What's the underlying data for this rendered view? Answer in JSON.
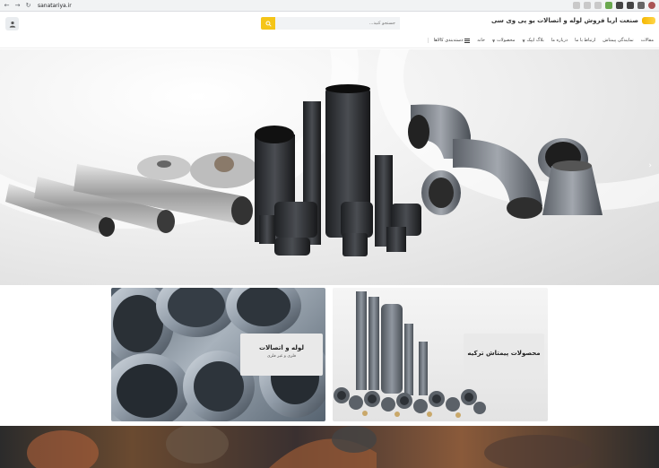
{
  "browser": {
    "url": "sanatariya.ir",
    "back_icon": "arrow-left-icon",
    "forward_icon": "arrow-right-icon",
    "reload_icon": "reload-icon"
  },
  "header": {
    "brand_title": "صنعت اریا فروش لوله و اتصالات یو پی وی سی",
    "search_placeholder": "جستجو کنید...",
    "search_icon": "search-icon",
    "user_icon": "user-icon",
    "accent_color": "#f5c518"
  },
  "nav": {
    "categories_label": "دسته‌بندی کالاها",
    "items": [
      "خانه",
      "محصولات",
      "بلاگ ایپک",
      "درباره ما",
      "ارتباط با ما",
      "نمایندگی پیمتاش",
      "مقالات"
    ]
  },
  "cards": {
    "pipes": {
      "title": "لوله و اتصالات",
      "subtitle": "فلزی و غیر فلزی"
    },
    "pimash": {
      "title": "محصولات پیمتاش ترکیه"
    }
  }
}
